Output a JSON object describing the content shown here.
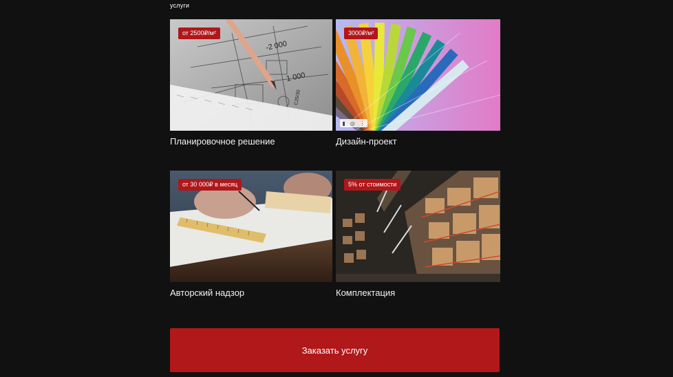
{
  "section": {
    "label": "услуги"
  },
  "cards": [
    {
      "title": "Планировочное решение",
      "price": "от 2500₽/м²",
      "image_icon": "blueprint-pencil-image"
    },
    {
      "title": "Дизайн-проект",
      "price": "3000₽/м²",
      "image_icon": "color-swatch-fan-image"
    },
    {
      "title": "Авторский надзор",
      "price": "от 30 000₽ в месяц",
      "image_icon": "drafting-hands-image"
    },
    {
      "title": "Комплектация",
      "price": "5% от стоимости",
      "image_icon": "warehouse-shelves-image"
    }
  ],
  "cta": {
    "label": "Заказать услугу"
  },
  "colors": {
    "background": "#111111",
    "accent": "#b0181a",
    "text": "#ffffff"
  }
}
